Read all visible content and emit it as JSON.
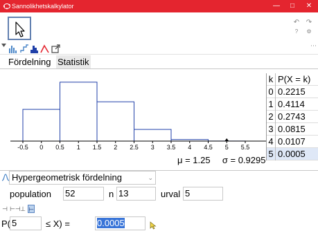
{
  "window": {
    "title": "Sannolikhetskalkylator",
    "controls": [
      "—",
      "□",
      "✕"
    ]
  },
  "toolbar": {
    "undo_icon": "undo-icon",
    "redo_icon": "redo-icon",
    "help_icon": "help-icon",
    "settings_icon": "gear-icon",
    "overflow": "⋯"
  },
  "tabs": [
    {
      "label": "Fördelning",
      "active": true
    },
    {
      "label": "Statistik",
      "active": false
    }
  ],
  "chart_data": {
    "type": "bar",
    "xlim": [
      -0.5,
      5.5
    ],
    "ticks": [
      "-0.5",
      "0",
      "0.5",
      "1",
      "1.5",
      "2",
      "2.5",
      "3",
      "3.5",
      "4",
      "4.5",
      "5",
      "5.5"
    ],
    "categories": [
      0,
      1,
      2,
      3,
      4,
      5
    ],
    "values": [
      0.2215,
      0.4114,
      0.2743,
      0.0815,
      0.0107,
      0.0005
    ],
    "highlight_category": 5,
    "bar_color": "#1f3fa8"
  },
  "stats": {
    "mean": "μ = 1.25",
    "sd": "σ = 0.9295"
  },
  "table": {
    "header_k": "k",
    "header_p": "P(X = k)",
    "rows": [
      {
        "k": "0",
        "p": "0.2215"
      },
      {
        "k": "1",
        "p": "0.4114"
      },
      {
        "k": "2",
        "p": "0.2743"
      },
      {
        "k": "3",
        "p": "0.0815"
      },
      {
        "k": "4",
        "p": "0.0107"
      },
      {
        "k": "5",
        "p": "0.0005"
      }
    ],
    "highlighted_row": 5
  },
  "distribution": {
    "selected": "Hypergeometrisk fördelning"
  },
  "params": {
    "population_label": "population",
    "population_value": "52",
    "n_label": "n",
    "n_value": "13",
    "urval_label": "urval",
    "urval_value": "5"
  },
  "probability": {
    "prefix": "P(",
    "lower_value": "5",
    "middle": "≤ X) =",
    "result": "0.0005"
  },
  "colors": {
    "titlebar": "#e4252f",
    "selection": "#3874d8",
    "highlight_row": "#dfe8f7"
  }
}
